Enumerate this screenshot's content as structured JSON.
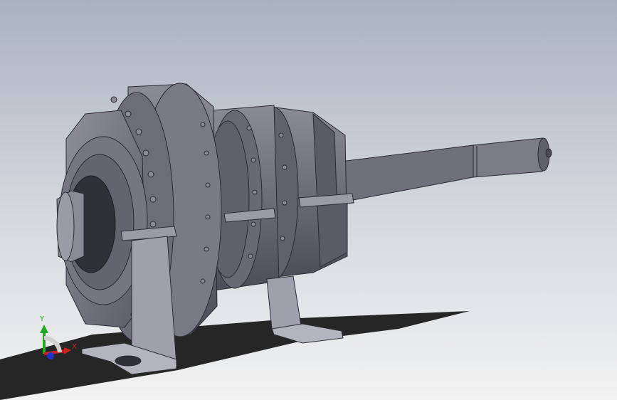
{
  "triad": {
    "x_label": "X",
    "y_label": "Y",
    "x_color": "#cc2222",
    "y_color": "#22aa22",
    "z_color": "#2233cc"
  },
  "model": {
    "body_color": "#6b6c78",
    "shadow_color": "#262626"
  }
}
